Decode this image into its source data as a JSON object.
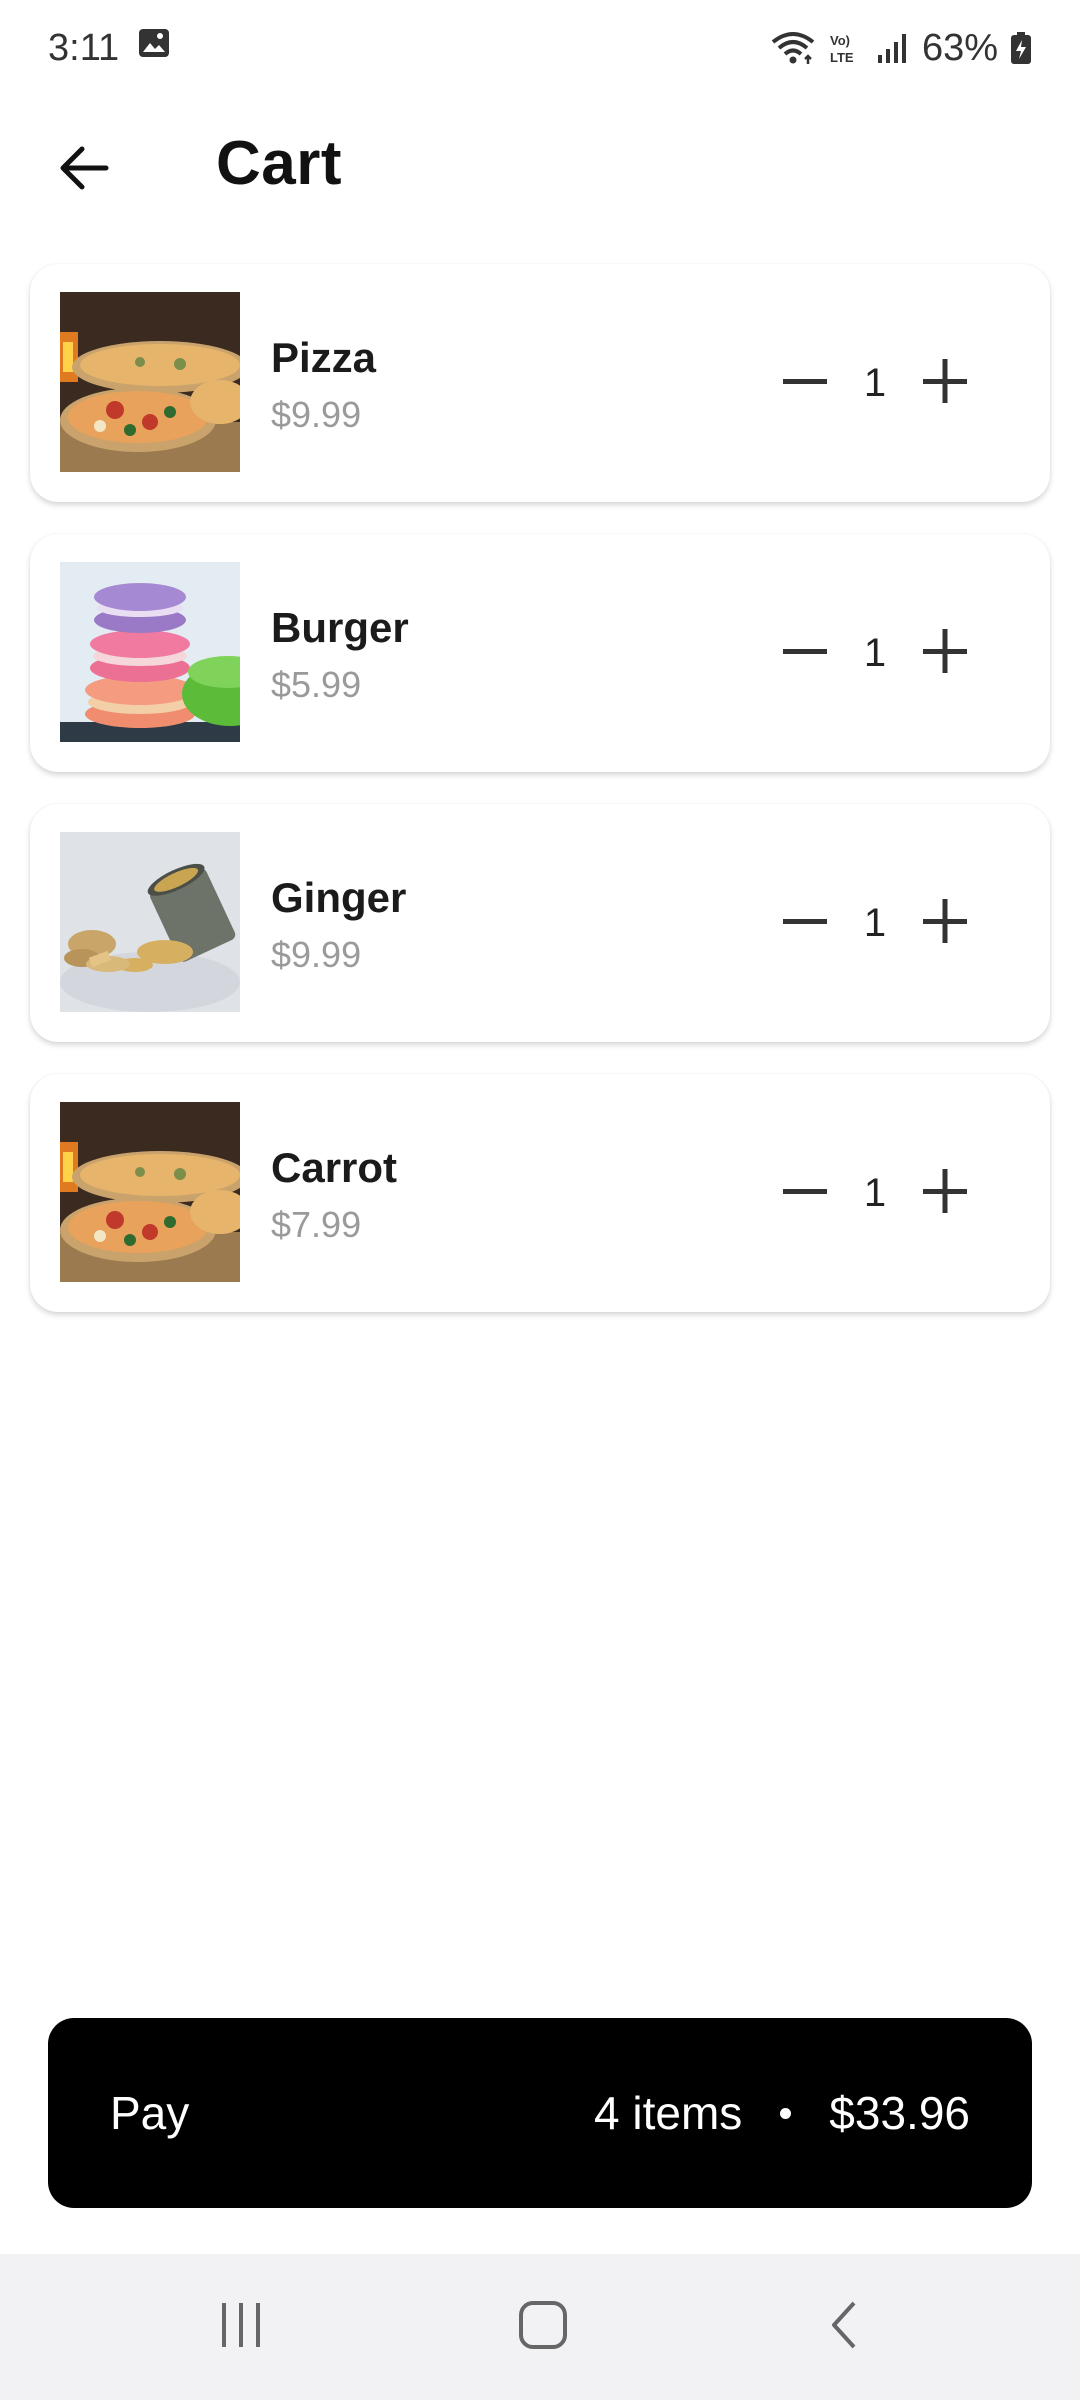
{
  "status_bar": {
    "time": "3:11",
    "battery_percent": "63%",
    "icons": [
      "gallery-icon",
      "wifi-icon",
      "volte-icon",
      "signal-icon",
      "battery-icon"
    ]
  },
  "app_bar": {
    "title": "Cart",
    "back_icon": "arrow-back-icon"
  },
  "cart": {
    "items": [
      {
        "name": "Pizza",
        "price": "$9.99",
        "quantity": "1",
        "image": "pizza-image"
      },
      {
        "name": "Burger",
        "price": "$5.99",
        "quantity": "1",
        "image": "macarons-image"
      },
      {
        "name": "Ginger",
        "price": "$9.99",
        "quantity": "1",
        "image": "ginger-image"
      },
      {
        "name": "Carrot",
        "price": "$7.99",
        "quantity": "1",
        "image": "pizza-image"
      }
    ]
  },
  "pay": {
    "label": "Pay",
    "items_count": "4 items",
    "total": "$33.96"
  },
  "nav_bar": {
    "icons": [
      "recent-apps-icon",
      "home-icon",
      "back-icon"
    ]
  },
  "colors": {
    "pay_background": "#000000",
    "price_text": "#9a9a9a",
    "nav_background": "#f2f2f4"
  }
}
